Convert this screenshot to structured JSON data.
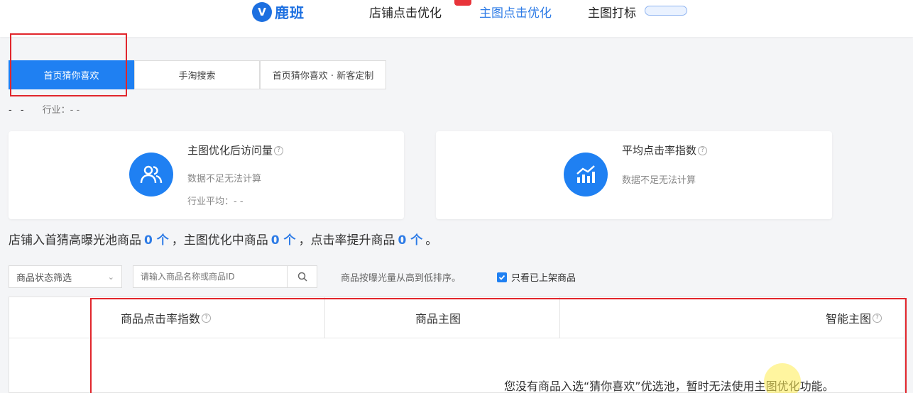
{
  "nav": {
    "logo_mark": "V",
    "logo_text": "鹿班",
    "items": [
      {
        "label": "店铺点击优化"
      },
      {
        "label": "主图点击优化"
      },
      {
        "label": "主图打标"
      }
    ],
    "accent_color": "#2d7be6"
  },
  "tabs": [
    {
      "label": "首页猜你喜欢"
    },
    {
      "label": "手淘搜索"
    },
    {
      "label": "首页猜你喜欢 · 新客定制"
    }
  ],
  "industry": {
    "prefix": "- -",
    "label": "行业：- -"
  },
  "cards": [
    {
      "icon": "users-icon",
      "title": "主图优化后访问量",
      "status": "数据不足无法计算",
      "industry_avg": "行业平均：- -"
    },
    {
      "icon": "chart-icon",
      "title": "平均点击率指数",
      "status": "数据不足无法计算"
    }
  ],
  "summary": {
    "part1": "店铺入首猜高曝光池商品",
    "count1": "0 个",
    "part2": "，主图优化中商品",
    "count2": "0 个",
    "part3": "，点击率提升商品",
    "count3": "0 个",
    "end": "。"
  },
  "filters": {
    "status_select": "商品状态筛选",
    "search_placeholder": "请输入商品名称或商品ID",
    "sort_note": "商品按曝光量从高到低排序。",
    "only_listed_label": "只看已上架商品",
    "only_listed_checked": true
  },
  "table": {
    "columns": [
      {
        "label": "商品点击率指数"
      },
      {
        "label": "商品主图"
      },
      {
        "label": "智能主图"
      }
    ],
    "empty_message": "您没有商品入选“猜你喜欢”优选池，暂时无法使用主图优化功能。"
  }
}
